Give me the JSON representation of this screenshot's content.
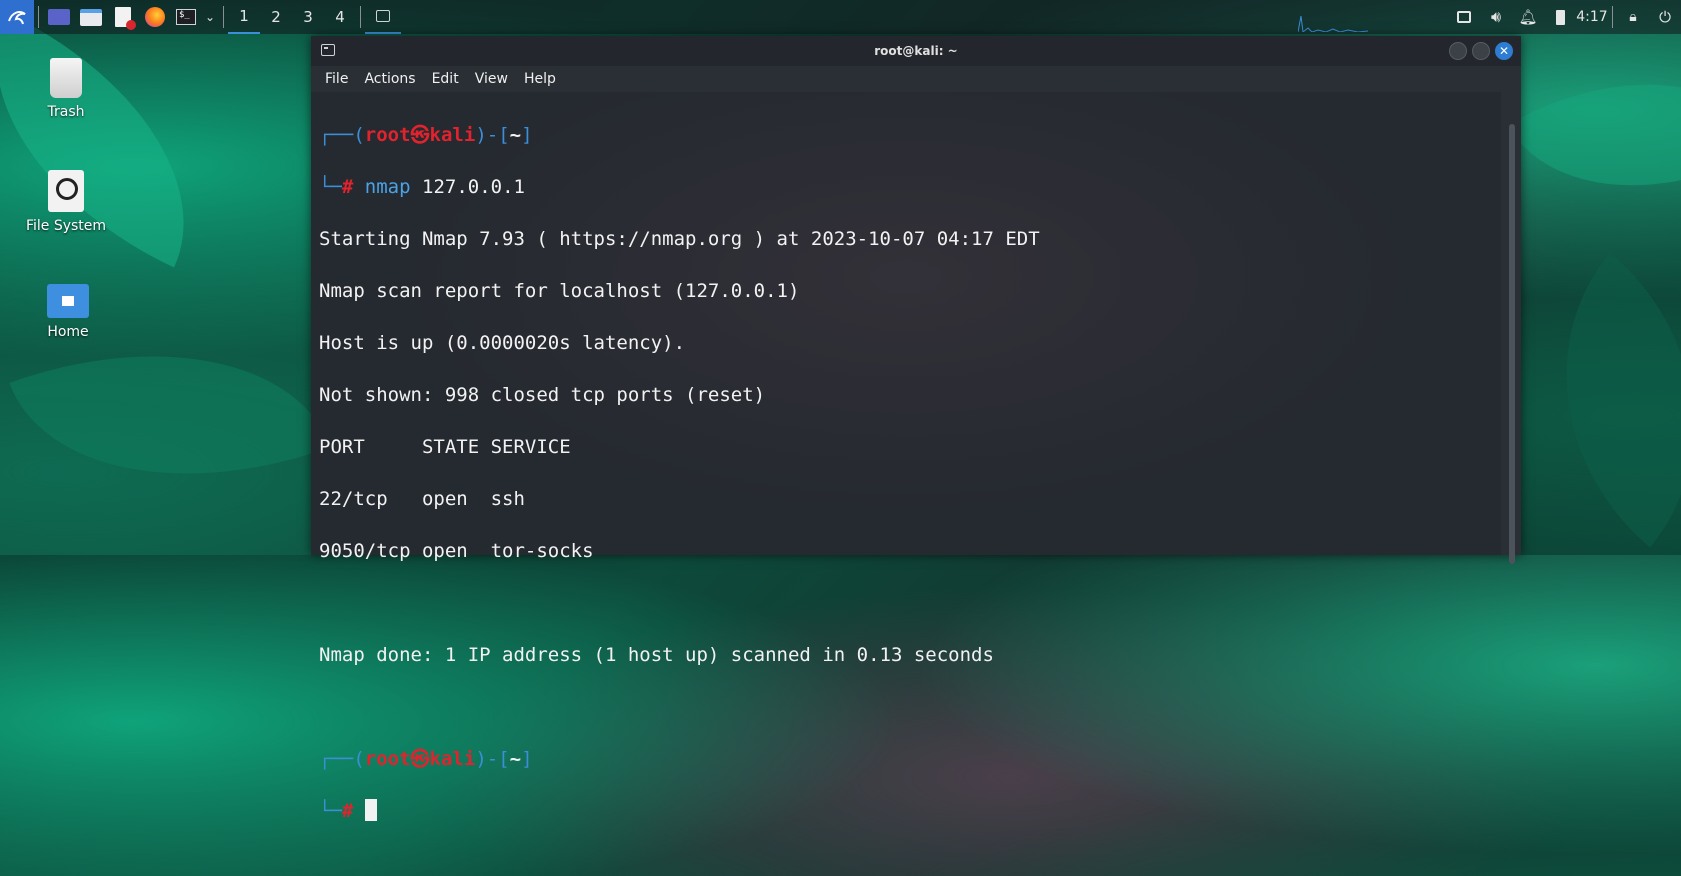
{
  "taskbar": {
    "workspaces": [
      "1",
      "2",
      "3",
      "4"
    ],
    "clock": "4:17",
    "icons": [
      "kali-menu-icon",
      "show-desktop-icon",
      "file-manager-icon",
      "text-editor-icon",
      "firefox-icon",
      "terminal-icon",
      "chevron-down-icon"
    ]
  },
  "desktop": {
    "icons": [
      {
        "label": "Trash"
      },
      {
        "label": "File System"
      },
      {
        "label": "Home"
      }
    ]
  },
  "window": {
    "title": "root@kali: ~",
    "menu": [
      "File",
      "Actions",
      "Edit",
      "View",
      "Help"
    ]
  },
  "terminal": {
    "prompt_user": "root",
    "prompt_host": "kali",
    "prompt_dir": "~",
    "command_name": "nmap",
    "command_args": " 127.0.0.1",
    "output": [
      "Starting Nmap 7.93 ( https://nmap.org ) at 2023-10-07 04:17 EDT",
      "Nmap scan report for localhost (127.0.0.1)",
      "Host is up (0.0000020s latency).",
      "Not shown: 998 closed tcp ports (reset)",
      "PORT     STATE SERVICE",
      "22/tcp   open  ssh",
      "9050/tcp open  tor-socks",
      "",
      "Nmap done: 1 IP address (1 host up) scanned in 0.13 seconds"
    ]
  },
  "colors": {
    "accent": "#3b8ed8",
    "prompt_red": "#e0232d"
  }
}
